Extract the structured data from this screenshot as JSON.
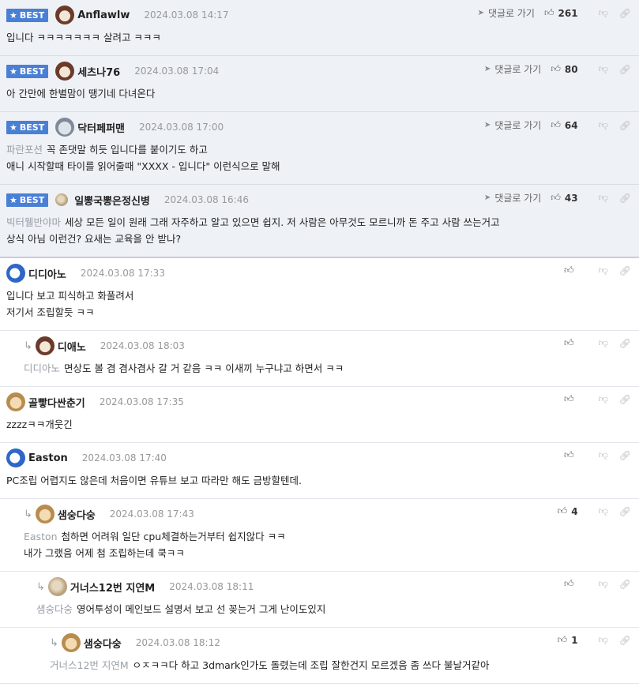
{
  "labels": {
    "best": "BEST",
    "reply_link": "댓글로 가기"
  },
  "icons": {
    "best_star": "star-icon",
    "reply_arrow": "send-arrow-icon",
    "like": "thumbs-up-icon",
    "dislike": "thumbs-down-icon",
    "link": "link-icon",
    "reply_indent": "reply-arrow-icon"
  },
  "colors": {
    "best_badge": "#4a7fd6",
    "best_bg": "#eef1f6",
    "tag_text": "#9aa0a8",
    "date_text": "#999999"
  },
  "best_comments": [
    {
      "author": "Anflawlw",
      "date": "2024.03.08 14:17",
      "likes": "261",
      "avatar": "bear-avatar",
      "lines": [
        "입니다 ㅋㅋㅋㅋㅋㅋㅋ 살려고 ㅋㅋㅋ"
      ],
      "tag": ""
    },
    {
      "author": "세츠나76",
      "date": "2024.03.08 17:04",
      "likes": "80",
      "avatar": "bear-avatar",
      "lines": [
        "아 간만에 한별맘이 땡기네 다녀온다"
      ],
      "tag": ""
    },
    {
      "author": "닥터페퍼맨",
      "date": "2024.03.08 17:00",
      "likes": "64",
      "avatar": "koala-avatar",
      "tag": "파란포션",
      "lines": [
        "꼭 존댓말 히듯 입니다를 붙이기도 하고",
        "애니 시작할때 타이를 읽어줄때 \"XXXX - 입니다\" 이런식으로 말해"
      ]
    },
    {
      "author": "일뽕국뽕은정신병",
      "date": "2024.03.08 16:46",
      "likes": "43",
      "avatar": "pebble-avatar",
      "tag": "빅터웰반야마",
      "lines": [
        "세상 모든 일이 원래 그래 자주하고 알고 있으면 쉽지. 저 사람은 아무것도 모르니까 돈 주고 사람 쓰는거고",
        "상식 아님 이런건? 요새는 교육을 안 받나?"
      ]
    }
  ],
  "comments": [
    {
      "author": "디디아노",
      "date": "2024.03.08 17:33",
      "likes": "",
      "avatar": "blue-avatar",
      "indent": 0,
      "tag": "",
      "lines": [
        "입니다 보고 피식하고 화풀려서",
        "저기서 조립할듯 ㅋㅋ"
      ]
    },
    {
      "author": "디애노",
      "date": "2024.03.08 18:03",
      "likes": "",
      "avatar": "bear-avatar",
      "indent": 1,
      "tag": "디디아노",
      "lines": [
        "면상도 볼 겸 겸사겸사 갈 거 같음 ㅋㅋ 이새끼 누구냐고 하면서 ㅋㅋ"
      ]
    },
    {
      "author": "골빻다싼춘기",
      "date": "2024.03.08 17:35",
      "likes": "",
      "avatar": "dog-avatar",
      "indent": 0,
      "tag": "",
      "lines": [
        "zzzzㅋㅋ개웃긴"
      ]
    },
    {
      "author": "Easton",
      "date": "2024.03.08 17:40",
      "likes": "",
      "avatar": "blue-avatar",
      "indent": 0,
      "tag": "",
      "lines": [
        "PC조립 어렵지도 않은데 처음이면 유튜브 보고 따라만 해도 금방할텐데."
      ]
    },
    {
      "author": "샘숭다숭",
      "date": "2024.03.08 17:43",
      "likes": "4",
      "avatar": "dog-avatar",
      "indent": 1,
      "tag": "Easton",
      "lines": [
        "첨하면 어려워 일단 cpu체결하는거부터 쉽지않다 ㅋㅋ",
        "내가 그랬음 어제 첨 조립하는데 쿡ㅋㅋ"
      ]
    },
    {
      "author": "거너스12번 지연M",
      "date": "2024.03.08 18:11",
      "likes": "",
      "avatar": "pebble-avatar",
      "indent": 2,
      "tag": "샘숭다숭",
      "lines": [
        "영어투성이 메인보드 설명서 보고 선 꽂는거 그게 난이도있지"
      ]
    },
    {
      "author": "샘숭다숭",
      "date": "2024.03.08 18:12",
      "likes": "1",
      "avatar": "dog-avatar",
      "indent": 3,
      "tag": "거너스12번 지연M",
      "lines": [
        "ㅇㅈㅋㅋ다 하고 3dmark인가도 돌렸는데 조립 잘한건지 모르겠음 좀 쓰다 불날거같아"
      ]
    }
  ]
}
